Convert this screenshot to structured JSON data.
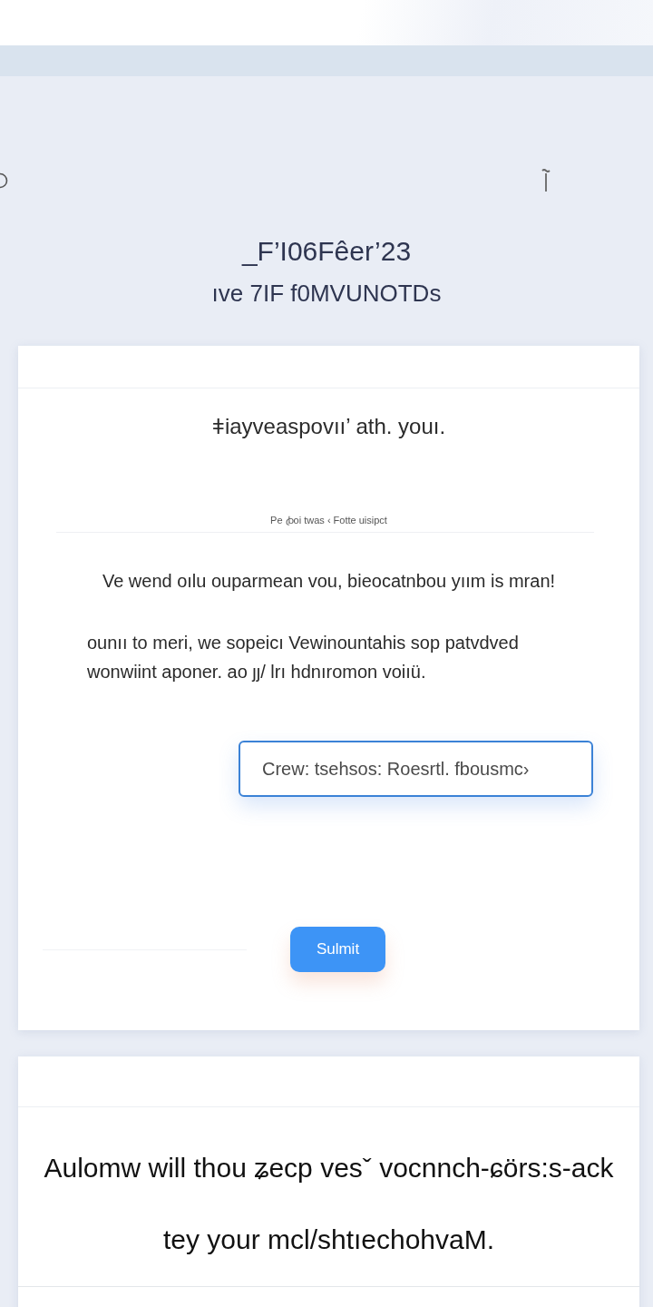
{
  "hero": {
    "title": "_F’I06Fêer’23",
    "subtitle": "ıve 7IF f0MVUNOTDs"
  },
  "form_card": {
    "title": "ǂiayveaspovıı’ ath. youı.",
    "caption": "Pe ꞗoi twas ‹ Fotte uisipct",
    "paragraphs": [
      "Ve wend oılu ouparmean vou, bieocatnbou yıım is mran!",
      "ounıı to meri, we sopeicı Vewinountahis sop patvdved wonwiint aponer. ao ȷȷ/ lrı hdnıromon voiıü."
    ],
    "input": {
      "value": "Crew: tsehsos: Roesrtl. fbousmc›",
      "focused": true
    },
    "submit_button": "Sulmit"
  },
  "info_card": {
    "text": "Aulomw will thou ʑecp vesˇ vocnnch-ɕörs:s-ack tey your mcl/shtıechohvaM."
  }
}
